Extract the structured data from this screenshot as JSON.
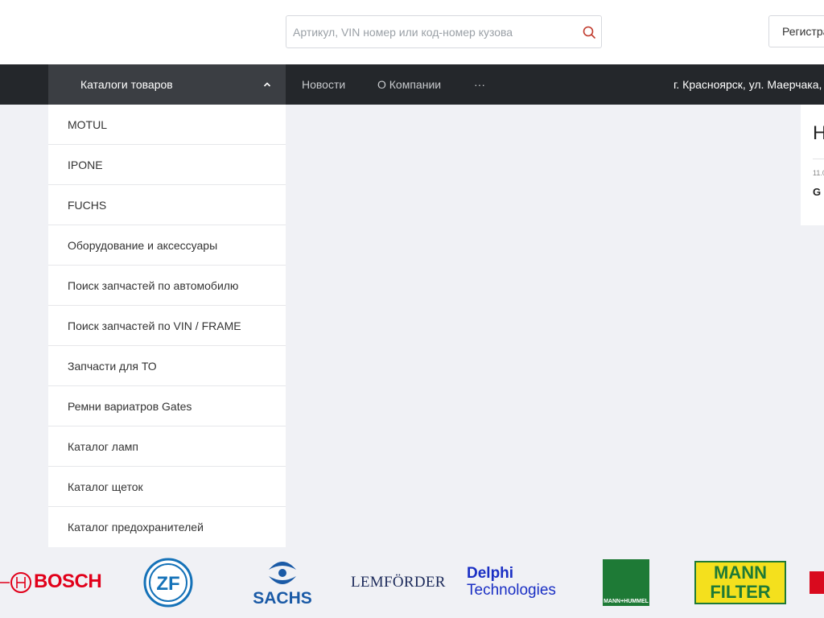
{
  "header": {
    "search_placeholder": "Артикул, VIN номер или код-номер кузова",
    "register_label": "Регистрация"
  },
  "nav": {
    "catalog_label": "Каталоги товаров",
    "links": [
      "Новости",
      "О Компании",
      "···"
    ],
    "address": "г. Красноярск, ул. Маерчака,"
  },
  "dropdown": {
    "items": [
      "MOTUL",
      "IPONE",
      "FUCHS",
      "Оборудование и аксессуары",
      "Поиск запчастей по автомобилю",
      "Поиск запчастей по VIN / FRAME",
      "Запчасти для ТО",
      "Ремни вариатров Gates",
      "Каталог ламп",
      "Каталог щеток",
      "Каталог предохранителей"
    ]
  },
  "news": {
    "heading": "Н",
    "date": "11.0",
    "title": "G"
  },
  "brands": {
    "bosch": "BOSCH",
    "zf": "ZF",
    "sachs": "SACHS",
    "lemforder": "LEMFÖRDER",
    "delphi_line1": "Delphi",
    "delphi_line2": "Technologies",
    "mann_hummel": "MANN+HUMMEL",
    "mann_line1": "MANN",
    "mann_line2": "FILTER"
  },
  "colors": {
    "navbar": "#24272b",
    "catalog_active": "#3b3e43",
    "page_bg": "#f0f1f5",
    "search_accent": "#c0392b"
  }
}
